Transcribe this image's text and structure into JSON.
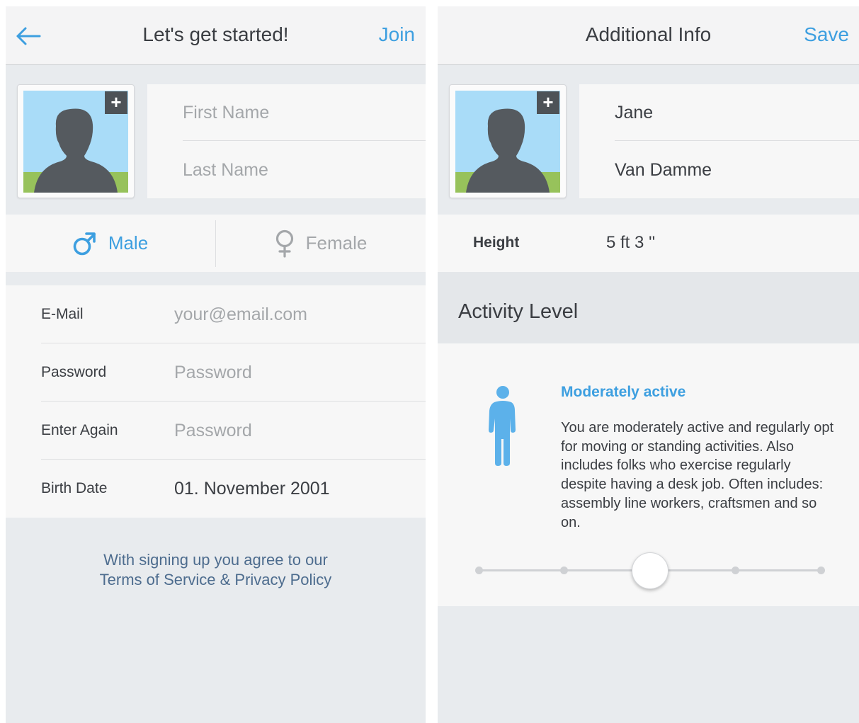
{
  "left_screen": {
    "nav": {
      "back_icon": "arrow-left-icon",
      "title": "Let's get started!",
      "action_label": "Join"
    },
    "avatar": {
      "plus_label": "+"
    },
    "name": {
      "first_placeholder": "First Name",
      "last_placeholder": "Last Name"
    },
    "gender": {
      "male_label": "Male",
      "female_label": "Female",
      "selected": "Male",
      "male_icon": "male-symbol-icon",
      "female_icon": "female-symbol-icon"
    },
    "form": [
      {
        "label": "E-Mail",
        "placeholder": "your@email.com",
        "value": ""
      },
      {
        "label": "Password",
        "placeholder": "Password",
        "value": ""
      },
      {
        "label": "Enter Again",
        "placeholder": "Password",
        "value": ""
      },
      {
        "label": "Birth Date",
        "placeholder": "",
        "value": "01. November 2001"
      }
    ],
    "terms": {
      "line1": "With signing up you agree to our",
      "line2": "Terms of Service & Privacy Policy"
    }
  },
  "right_screen": {
    "nav": {
      "title": "Additional Info",
      "action_label": "Save"
    },
    "avatar": {
      "plus_label": "+"
    },
    "name": {
      "first_value": "Jane",
      "last_value": "Van Damme"
    },
    "height": {
      "label": "Height",
      "value": "5 ft 3 ''"
    },
    "activity": {
      "section_title": "Activity Level",
      "level_title": "Moderately active",
      "description": "You are moderately active and regularly opt for moving or standing activities. Also includes folks who exercise regularly despite having a desk job. Often includes: assembly line workers, craftsmen and so on.",
      "figure_icon": "standing-person-icon",
      "slider": {
        "steps": 5,
        "selected_index": 2
      }
    }
  },
  "colors": {
    "accent": "#3d9fe0",
    "background": "#e8ebee",
    "panel": "#f7f7f7",
    "text_dark": "#3b3e43",
    "placeholder": "#a4a7aa",
    "avatar_sky": "#a9dcf8",
    "avatar_grass": "#97c25b",
    "avatar_silhouette": "#555a5f",
    "terms_text": "#4d6c8e"
  }
}
